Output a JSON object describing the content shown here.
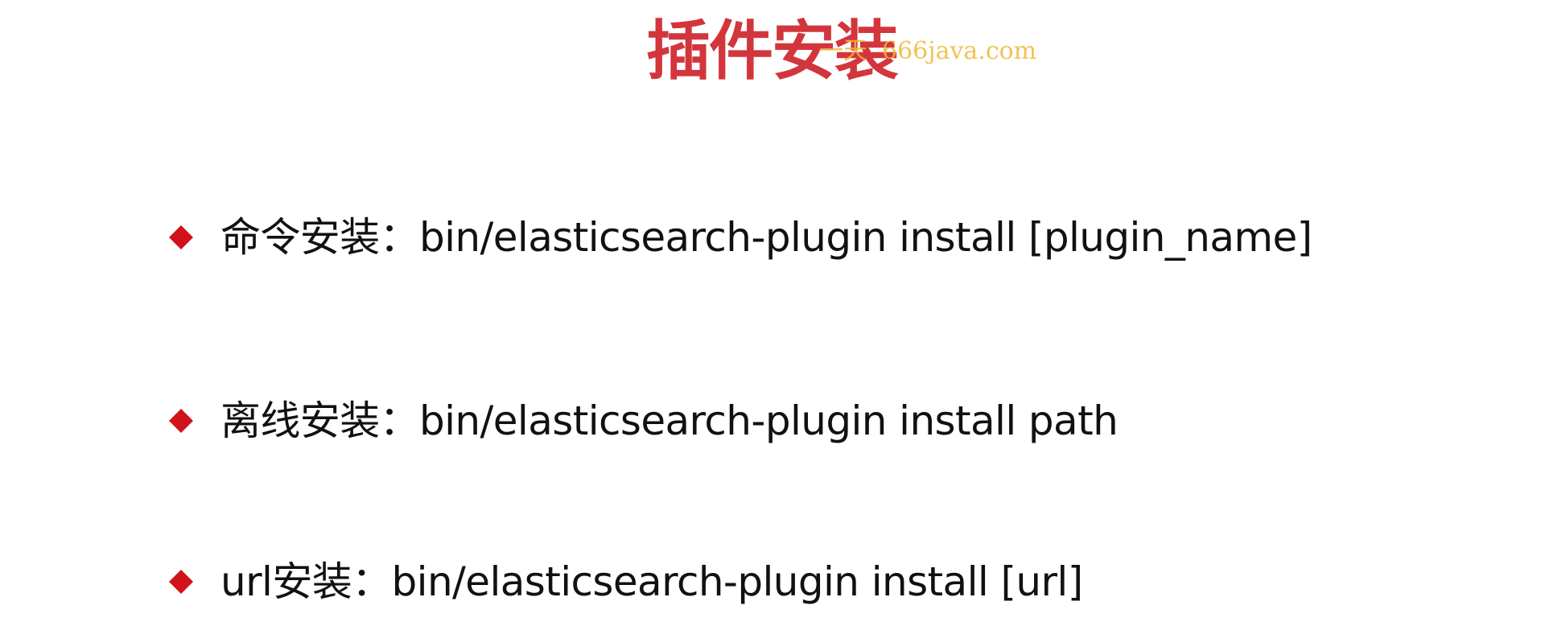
{
  "title": "插件安装",
  "watermark": {
    "mark": "一天",
    "site": "666java.com"
  },
  "bullets": [
    {
      "icon": "diamond-icon",
      "text": "命令安装：bin/elasticsearch-plugin install [plugin_name]"
    },
    {
      "icon": "diamond-icon",
      "text": "离线安装：bin/elasticsearch-plugin install path"
    },
    {
      "icon": "diamond-icon",
      "text": "url安装：bin/elasticsearch-plugin install [url]"
    }
  ],
  "colors": {
    "title": "#d2363c",
    "bullet": "#d0121a",
    "text": "#111111",
    "watermark": "#f0b838"
  }
}
